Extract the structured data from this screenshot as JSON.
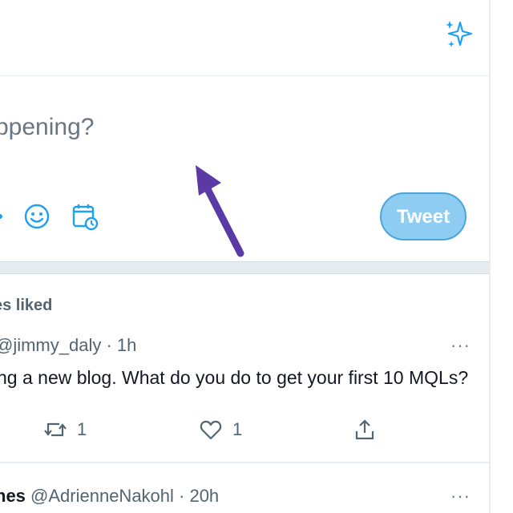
{
  "composer": {
    "placeholder": "ppening?",
    "tweet_button_label": "Tweet"
  },
  "icons": {
    "header": "sparkle-icon",
    "composer_tools": [
      "gif-icon",
      "emoji-icon",
      "schedule-icon"
    ],
    "tweet_actions": [
      "retweet-icon",
      "like-icon",
      "share-icon"
    ],
    "more": "more-icon"
  },
  "colors": {
    "accent": "#1da1f2",
    "tweet_button_bg": "#8ecdf1",
    "annotation_arrow": "#5b3aa6",
    "muted_text": "#536471"
  },
  "tweets": [
    {
      "social_context": "es liked",
      "handle_time": "@jimmy_daly · 1h",
      "more": "···",
      "text": "ng a new blog. What do you do to get your first 10 MQLs?",
      "retweets": "1",
      "likes": "1"
    },
    {
      "name": "nes",
      "handle_time": " @AdrienneNakohl · 20h",
      "more": "···"
    }
  ]
}
